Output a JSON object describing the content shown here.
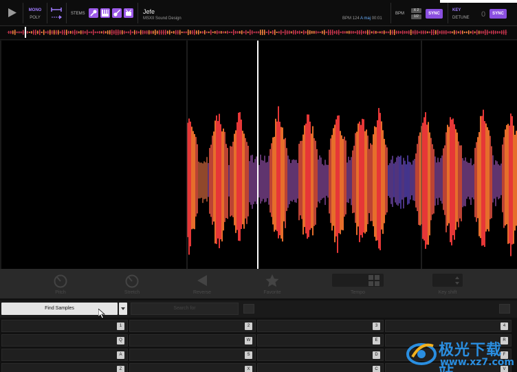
{
  "toolbar": {
    "mono_label": "MONO",
    "poly_label": "POLY",
    "stems_label": "STEMS",
    "stems": [
      {
        "name": "vocals",
        "icon": "microphone-icon"
      },
      {
        "name": "keys",
        "icon": "piano-icon"
      },
      {
        "name": "guitar",
        "icon": "guitar-icon"
      },
      {
        "name": "drums",
        "icon": "drum-icon"
      }
    ],
    "track_title": "Jefe",
    "track_artist": "MSXII Sound Design",
    "bpm_text": "BPM 124",
    "key_text": "A maj",
    "time_text": "00:01",
    "bpm_label": "BPM",
    "mult_x2": "X 2",
    "mult_half": "1/2",
    "sync_label": "SYNC",
    "key_label": "KEY",
    "detune_label": "DETUNE",
    "key_value": "0",
    "accent_color": "#8a4fe0"
  },
  "pad_controls": [
    {
      "name": "pitch",
      "label": "Pitch",
      "icon": "knob-icon"
    },
    {
      "name": "stretch",
      "label": "Stretch",
      "icon": "knob-icon"
    },
    {
      "name": "reverse",
      "label": "Reverse",
      "icon": "reverse-icon"
    },
    {
      "name": "favorite",
      "label": "Favorite",
      "icon": "star-icon"
    },
    {
      "name": "tempo",
      "label": "Tempo",
      "icon": "stepper-icon"
    },
    {
      "name": "key",
      "label": "Key shift",
      "icon": "stepper-icon"
    }
  ],
  "search": {
    "find_label": "Find Samples",
    "field_placeholder": "Search for"
  },
  "pad_keys": [
    [
      "1",
      "2",
      "3",
      "4"
    ],
    [
      "Q",
      "W",
      "E",
      "R"
    ],
    [
      "A",
      "S",
      "D",
      "F"
    ],
    [
      "Z",
      "X",
      "C",
      "V"
    ]
  ],
  "watermark": {
    "title": "极光下载站",
    "url": "www.xz7.com"
  }
}
